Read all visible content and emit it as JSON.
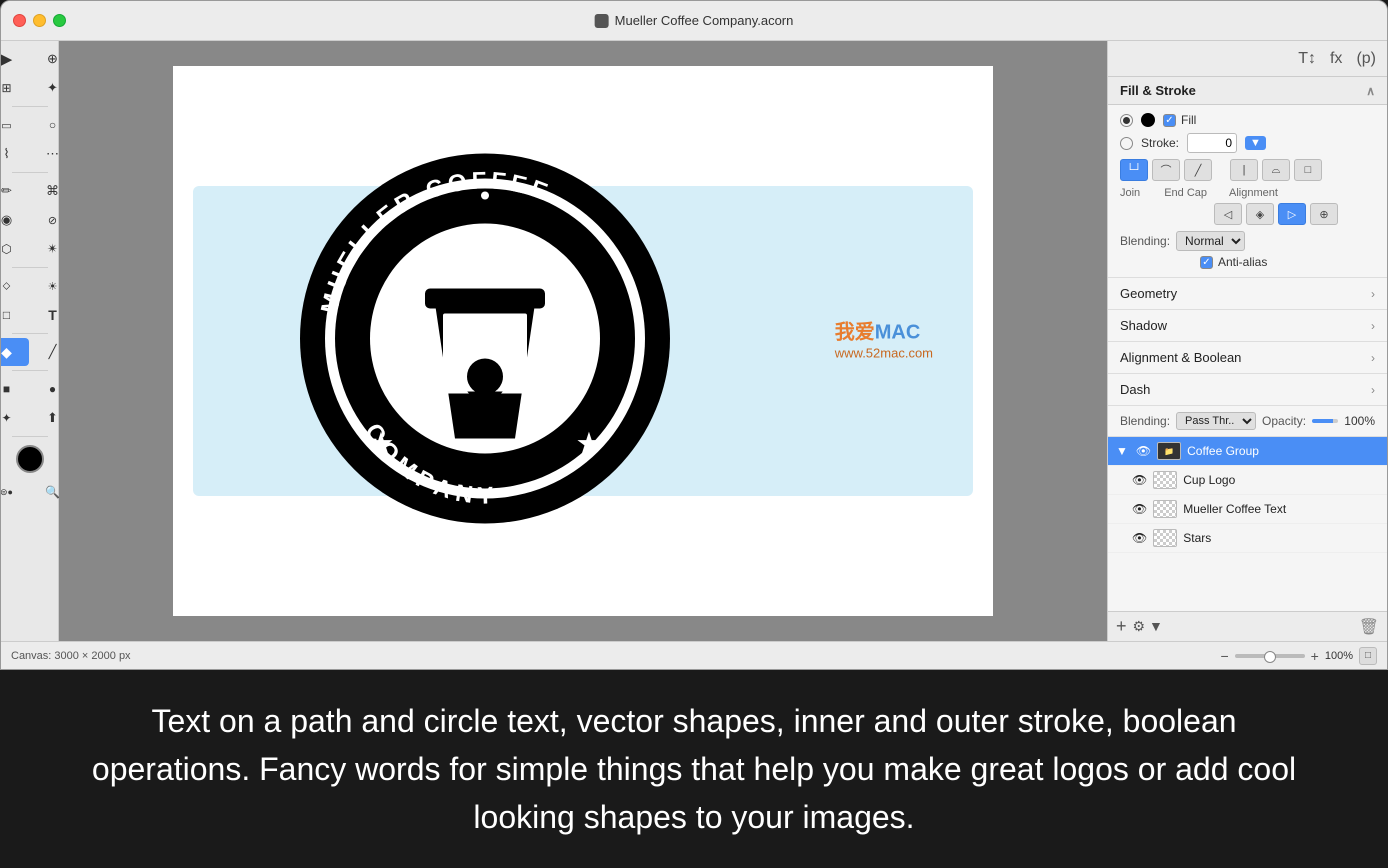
{
  "window": {
    "title": "Mueller Coffee Company.acorn",
    "controls": {
      "close": "×",
      "min": "–",
      "max": "+"
    }
  },
  "right_panel": {
    "icons": [
      "T↕",
      "fx",
      "(p)"
    ],
    "fill_stroke": {
      "header": "Fill & Stroke",
      "fill_label": "Fill",
      "stroke_label": "Stroke:",
      "stroke_value": "0",
      "join_label": "Join",
      "end_cap_label": "End Cap",
      "alignment_label": "Alignment",
      "blending_label": "Blending:",
      "blending_value": "Normal",
      "antialias_label": "Anti-alias"
    },
    "geometry": {
      "header": "Geometry"
    },
    "shadow": {
      "header": "Shadow"
    },
    "alignment_boolean": {
      "header": "Alignment & Boolean"
    },
    "dash": {
      "header": "Dash"
    },
    "layers": {
      "blending_label": "Blending:",
      "blending_value": "Pass Thr...",
      "opacity_label": "Opacity:",
      "opacity_value": "100%",
      "items": [
        {
          "name": "Coffee Group",
          "expanded": true,
          "visible": true,
          "selected": true,
          "indent": 0
        },
        {
          "name": "Cup Logo",
          "expanded": false,
          "visible": true,
          "selected": false,
          "indent": 1
        },
        {
          "name": "Mueller Coffee Text",
          "expanded": false,
          "visible": true,
          "selected": false,
          "indent": 1
        },
        {
          "name": "Stars",
          "expanded": false,
          "visible": true,
          "selected": false,
          "indent": 1
        }
      ]
    }
  },
  "bottom_bar": {
    "canvas_info": "Canvas: 3000 × 2000 px",
    "zoom_pct": "100%"
  },
  "caption": {
    "text": "Text on a path and circle text, vector shapes, inner and outer stroke, boolean operations. Fancy words for simple things that help you make great logos or add cool looking shapes to your images."
  },
  "tools": {
    "left": [
      {
        "icon": "▶",
        "name": "selection-tool"
      },
      {
        "icon": "⊕",
        "name": "zoom-tool"
      },
      {
        "icon": "⊞",
        "name": "crop-tool"
      },
      {
        "icon": "✛",
        "name": "move-tool"
      },
      {
        "icon": "⬡",
        "name": "polygon-select"
      },
      {
        "icon": "○",
        "name": "ellipse-select"
      },
      {
        "icon": "⌇",
        "name": "lasso-tool"
      },
      {
        "icon": "⋯",
        "name": "magnetic-lasso"
      },
      {
        "icon": "✏",
        "name": "pencil-tool"
      },
      {
        "icon": "⌘",
        "name": "pen-tool"
      },
      {
        "icon": "◉",
        "name": "paint-bucket"
      },
      {
        "icon": "⬜",
        "name": "rectangle-tool"
      },
      {
        "icon": "T",
        "name": "text-tool"
      },
      {
        "icon": "◆",
        "name": "vector-tool"
      },
      {
        "icon": "✴",
        "name": "star-tool"
      },
      {
        "icon": "⬆",
        "name": "bezier-tool"
      },
      {
        "icon": "■",
        "name": "rect-shape"
      },
      {
        "icon": "●",
        "name": "ellipse-shape"
      },
      {
        "icon": "✦",
        "name": "custom-shape"
      },
      {
        "icon": "⬣",
        "name": "other-shape"
      }
    ]
  }
}
